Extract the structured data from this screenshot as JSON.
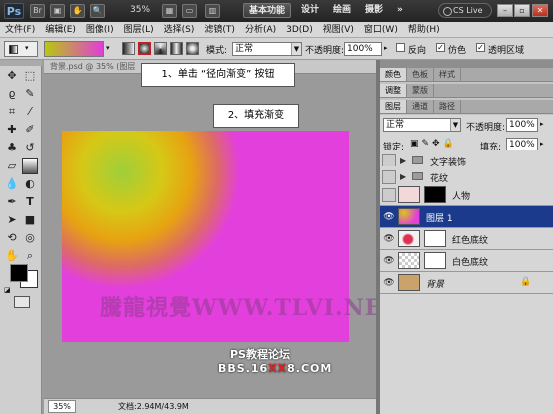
{
  "titlebar": {
    "app_logo": "Ps",
    "zoom": "35%",
    "workspace_buttons": [
      "基本功能",
      "设计",
      "绘画",
      "摄影"
    ],
    "more": "»",
    "cs_live": "CS Live",
    "window_controls": [
      "minimize-icon",
      "restore-icon",
      "close-icon"
    ]
  },
  "menubar": {
    "items": [
      "文件(F)",
      "编辑(E)",
      "图像(I)",
      "图层(L)",
      "选择(S)",
      "滤镜(T)",
      "分析(A)",
      "3D(D)",
      "视图(V)",
      "窗口(W)",
      "帮助(H)"
    ]
  },
  "options": {
    "mode_label": "模式:",
    "mode_value": "正常",
    "opacity_label": "不透明度:",
    "opacity_value": "100%",
    "reverse_label": "反向",
    "dither_label": "仿色",
    "transparency_label": "透明区域",
    "gradient_colors": [
      "#b8c80e",
      "#e03ed8"
    ]
  },
  "document": {
    "tab_title": "背景.psd @ 35% (图层",
    "zoom": "35%",
    "doc_info": "文档:2.94M/43.9M",
    "canvas_color": "#e33fdd",
    "watermark": "騰龍視覺WWW.TLVI.NET"
  },
  "callouts": {
    "step1": "1、单击 “径向渐变” 按钮",
    "step2": "2、填充渐变"
  },
  "site": {
    "line1": "PS教程论坛",
    "line2_a": "BBS.16",
    "line2_b": "XX",
    "line2_c": "8.COM"
  },
  "panels": {
    "top_tabs": [
      "颜色",
      "色板",
      "样式"
    ],
    "adjust_tabs": [
      "调整",
      "蒙版"
    ],
    "layer_tabs": [
      "图层",
      "通道",
      "路径"
    ],
    "blend_mode": "正常",
    "opacity_label": "不透明度:",
    "opacity_value": "100%",
    "lock_label": "锁定:",
    "fill_label": "填充:",
    "fill_value": "100%",
    "layers": [
      {
        "name": "文字装饰",
        "kind": "group"
      },
      {
        "name": "花纹",
        "kind": "group"
      },
      {
        "name": "人物",
        "kind": "layer"
      },
      {
        "name": "图层 1",
        "kind": "layer",
        "selected": true
      },
      {
        "name": "红色底纹",
        "kind": "layer"
      },
      {
        "name": "白色底纹",
        "kind": "layer"
      },
      {
        "name": "背景",
        "kind": "background"
      }
    ]
  }
}
